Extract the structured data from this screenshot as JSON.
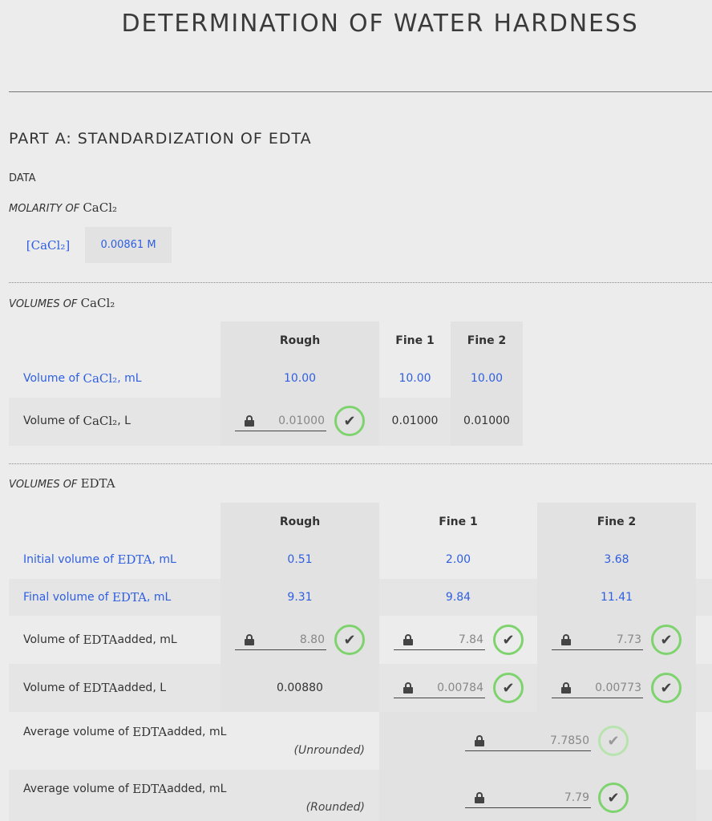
{
  "title": "DETERMINATION OF WATER HARDNESS",
  "part_a": "PART A: STANDARDIZATION OF EDTA",
  "data_label": "DATA",
  "molarity": {
    "label_prefix": "MOLARITY OF",
    "label_chem": "CaCl₂",
    "symbol": "[CaCl₂]",
    "value": "0.00861 M"
  },
  "vol_cacl2": {
    "label_prefix": "VOLUMES OF",
    "label_chem": "CaCl₂",
    "headers": [
      "Rough",
      "Fine 1",
      "Fine 2"
    ],
    "row1": {
      "label_pre": "Volume of",
      "chem": "CaCl₂",
      "label_post": ", mL",
      "values": [
        "10.00",
        "10.00",
        "10.00"
      ]
    },
    "row2": {
      "label_pre": "Volume of",
      "chem": "CaCl₂",
      "label_post": ", L",
      "values": [
        "0.01000",
        "0.01000",
        "0.01000"
      ]
    }
  },
  "vol_edta": {
    "label_prefix": "VOLUMES OF",
    "label_chem": "EDTA",
    "headers": [
      "Rough",
      "Fine 1",
      "Fine 2"
    ],
    "initial": {
      "label_pre": "Initial volume of",
      "chem": "EDTA",
      "label_post": ", mL",
      "values": [
        "0.51",
        "2.00",
        "3.68"
      ]
    },
    "final": {
      "label_pre": "Final volume of",
      "chem": "EDTA",
      "label_post": ", mL",
      "values": [
        "9.31",
        "9.84",
        "11.41"
      ]
    },
    "added_ml": {
      "label_pre": "Volume of",
      "chem": "EDTA",
      "label_post": " added, mL",
      "values": [
        "8.80",
        "7.84",
        "7.73"
      ]
    },
    "added_l": {
      "label_pre": "Volume of",
      "chem": "EDTA",
      "label_post": " added, L",
      "values": [
        "0.00880",
        "0.00784",
        "0.00773"
      ]
    },
    "avg_unrounded": {
      "label_pre": "Average volume of",
      "chem": "EDTA",
      "label_post": " added, mL",
      "note": "(Unrounded)",
      "value": "7.7850"
    },
    "avg_rounded": {
      "label_pre": "Average volume of",
      "chem": "EDTA",
      "label_post": " added, mL",
      "note": "(Rounded)",
      "value": "7.79"
    }
  },
  "colors": {
    "blue_text": "#2f5fe0",
    "check_green": "#7ed36e"
  },
  "icons": {
    "lock": "lock-icon",
    "check": "check-circle-icon"
  }
}
